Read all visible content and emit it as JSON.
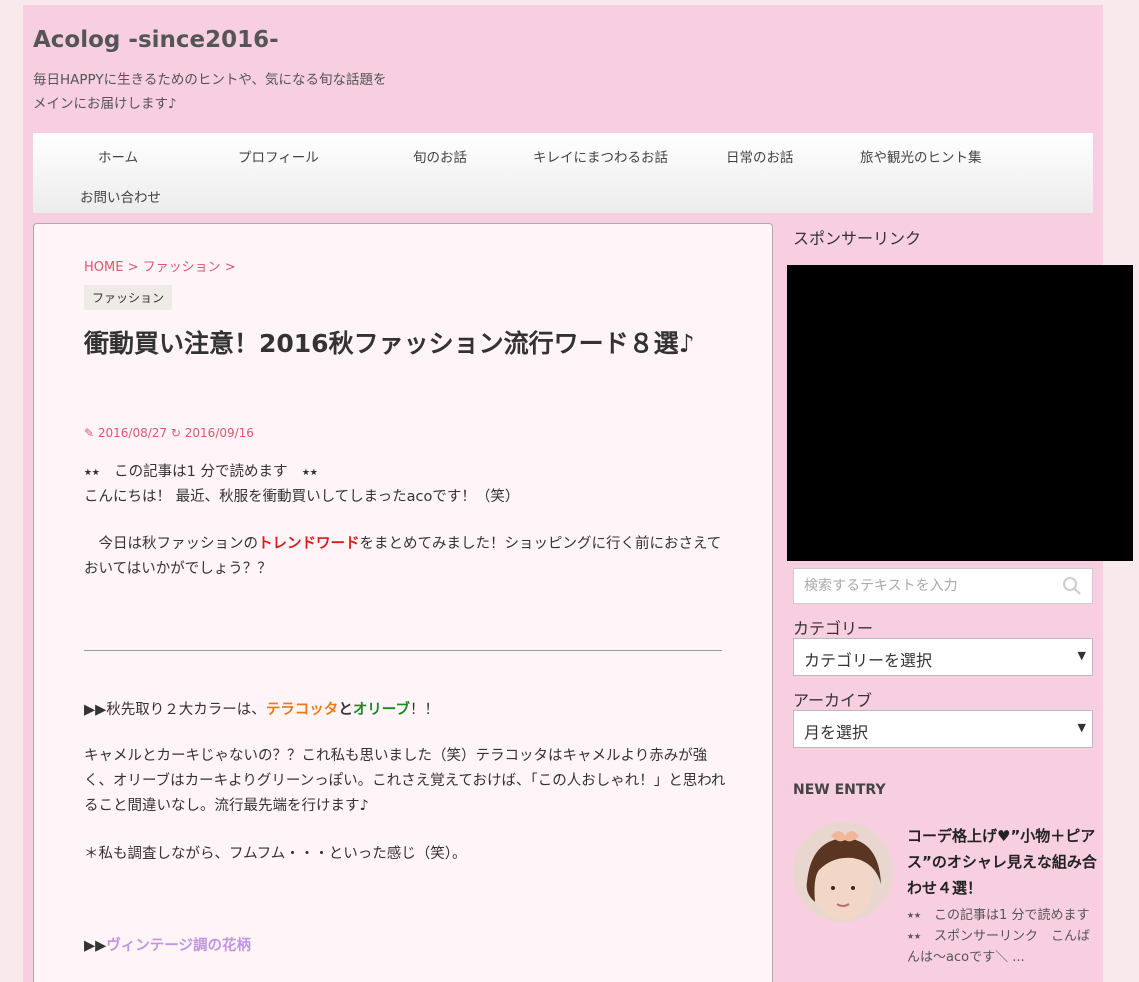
{
  "site": {
    "title": "Acolog -since2016-",
    "description_line1": "毎日HAPPYに生きるためのヒントや、気になる旬な話題を",
    "description_line2": "メインにお届けします♪"
  },
  "nav": {
    "items": [
      "ホーム",
      "プロフィール",
      "旬のお話",
      "キレイにまつわるお話",
      "日常のお話",
      "旅や観光のヒント集",
      "お問い合わせ"
    ]
  },
  "article": {
    "breadcrumb": [
      "HOME",
      ">",
      "ファッション",
      ">"
    ],
    "category": "ファッション",
    "title": "衝動買い注意！2016秋ファッション流行ワード８選♪",
    "posted_date": "2016/08/27",
    "updated_date": "2016/09/16",
    "reading_time": "⭑⭑　この記事は1 分で読めます　⭑⭑",
    "greeting": "こんにちは！ 最近、秋服を衝動買いしてしまったacoです！（笑）",
    "intro_before": "　今日は秋ファッションの",
    "intro_highlight": "トレンドワード",
    "intro_after": "をまとめてみました！ショッピングに行く前におさえておいてはいかがでしょう？？",
    "section1_prefix": "▶▶秋先取り２大カラーは、",
    "section1_color1": "テラコッタ",
    "section1_and": "と",
    "section1_color2": "オリーブ",
    "section1_suffix": "！！",
    "section1_body": "キャメルとカーキじゃないの？？これ私も思いました（笑）テラコッタはキャメルより赤みが強く、オリーブはカーキよりグリーンっぽい。これさえ覚えておけば、「この人おしゃれ！」と思われること間違いなし。流行最先端を行けます♪",
    "section1_note": "＊私も調査しながら、フムフム・・・といった感じ（笑）。",
    "section2_prefix": "▶▶",
    "section2_title": "ヴィンテージ調の花柄"
  },
  "sidebar": {
    "sponsor_title": "スポンサーリンク",
    "search_placeholder": "検索するテキストを入力",
    "category_label": "カテゴリー",
    "category_select": "カテゴリーを選択",
    "archive_label": "アーカイブ",
    "archive_select": "月を選択",
    "new_entry_label": "NEW ENTRY",
    "entry_title": "コーデ格上げ♥”小物＋ピアス”のオシャレ見えな組み合わせ４選！",
    "entry_excerpt": "⭑⭑　この記事は1 分で読めます　⭑⭑　スポンサーリンク　こんばんは〜acoです＼ ..."
  },
  "colors": {
    "page_bg": "#f7e9ec",
    "header_bg": "#f7cfe0",
    "article_bg": "#fff4f7",
    "link": "#e0566f",
    "trend_red": "#d91c1c",
    "terracotta": "#e87a18",
    "olive": "#1f8a1f",
    "vintage_purple": "#c196e0"
  }
}
